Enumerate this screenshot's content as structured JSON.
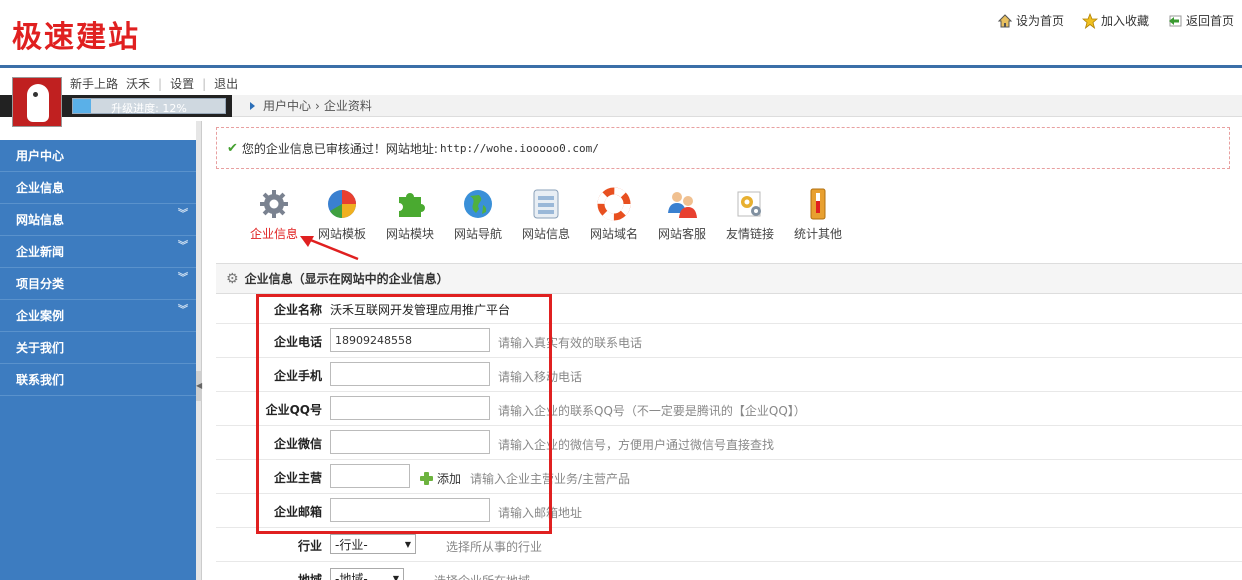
{
  "header": {
    "logo": "极速建站",
    "links": [
      {
        "label": "设为首页",
        "icon": "home-icon"
      },
      {
        "label": "加入收藏",
        "icon": "star-icon"
      },
      {
        "label": "返回首页",
        "icon": "back-arrow-icon"
      }
    ]
  },
  "user": {
    "level": "新手上路",
    "name": "沃禾",
    "settings": "设置",
    "logout": "退出",
    "progress_label": "升级进度: 12%",
    "progress_value": 0.12
  },
  "breadcrumb": [
    "用户中心",
    "企业资料"
  ],
  "sidebar": {
    "items": [
      {
        "label": "用户中心",
        "expandable": false
      },
      {
        "label": "企业信息",
        "expandable": false
      },
      {
        "label": "网站信息",
        "expandable": true
      },
      {
        "label": "企业新闻",
        "expandable": true
      },
      {
        "label": "项目分类",
        "expandable": true
      },
      {
        "label": "企业案例",
        "expandable": true
      },
      {
        "label": "关于我们",
        "expandable": false
      },
      {
        "label": "联系我们",
        "expandable": false
      }
    ]
  },
  "notice": {
    "text": "您的企业信息已审核通过！网站地址:",
    "url": "http://wohe.iooooo0.com/"
  },
  "toolbar": {
    "items": [
      {
        "label": "企业信息",
        "icon": "gear-icon",
        "active": true
      },
      {
        "label": "网站模板",
        "icon": "pie-chart-icon",
        "active": false
      },
      {
        "label": "网站模块",
        "icon": "puzzle-icon",
        "active": false
      },
      {
        "label": "网站导航",
        "icon": "globe-icon",
        "active": false
      },
      {
        "label": "网站信息",
        "icon": "form-icon",
        "active": false
      },
      {
        "label": "网站域名",
        "icon": "lifebuoy-icon",
        "active": false
      },
      {
        "label": "网站客服",
        "icon": "users-icon",
        "active": false
      },
      {
        "label": "友情链接",
        "icon": "link-gears-icon",
        "active": false
      },
      {
        "label": "统计其他",
        "icon": "thermometer-icon",
        "active": false
      }
    ]
  },
  "form": {
    "title": "企业信息（显示在网站中的企业信息）",
    "company_name": {
      "label": "企业名称",
      "value": "沃禾互联网开发管理应用推广平台"
    },
    "phone": {
      "label": "企业电话",
      "value": "18909248558",
      "hint": "请输入真实有效的联系电话"
    },
    "mobile": {
      "label": "企业手机",
      "value": "",
      "hint": "请输入移动电话"
    },
    "qq": {
      "label": "企业QQ号",
      "value": "",
      "hint": "请输入企业的联系QQ号（不一定要是腾讯的【企业QQ】）"
    },
    "wechat": {
      "label": "企业微信",
      "value": "",
      "hint": "请输入企业的微信号，方便用户通过微信号直接查找"
    },
    "business": {
      "label": "企业主营",
      "value": "",
      "add_label": "添加",
      "hint": "请输入企业主营业务/主营产品"
    },
    "email": {
      "label": "企业邮箱",
      "value": "",
      "hint": "请输入邮箱地址"
    },
    "industry": {
      "label": "行业",
      "selected": "-行业-",
      "hint": "选择所从事的行业"
    },
    "region": {
      "label": "地域",
      "selected": "-地域-",
      "hint": "选择企业所在地域"
    }
  }
}
